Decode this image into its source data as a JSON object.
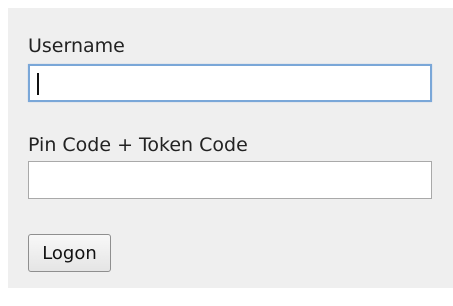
{
  "form": {
    "username": {
      "label": "Username",
      "value": ""
    },
    "pin_token": {
      "label": "Pin Code + Token Code",
      "value": ""
    },
    "submit": {
      "label": "Logon"
    }
  }
}
